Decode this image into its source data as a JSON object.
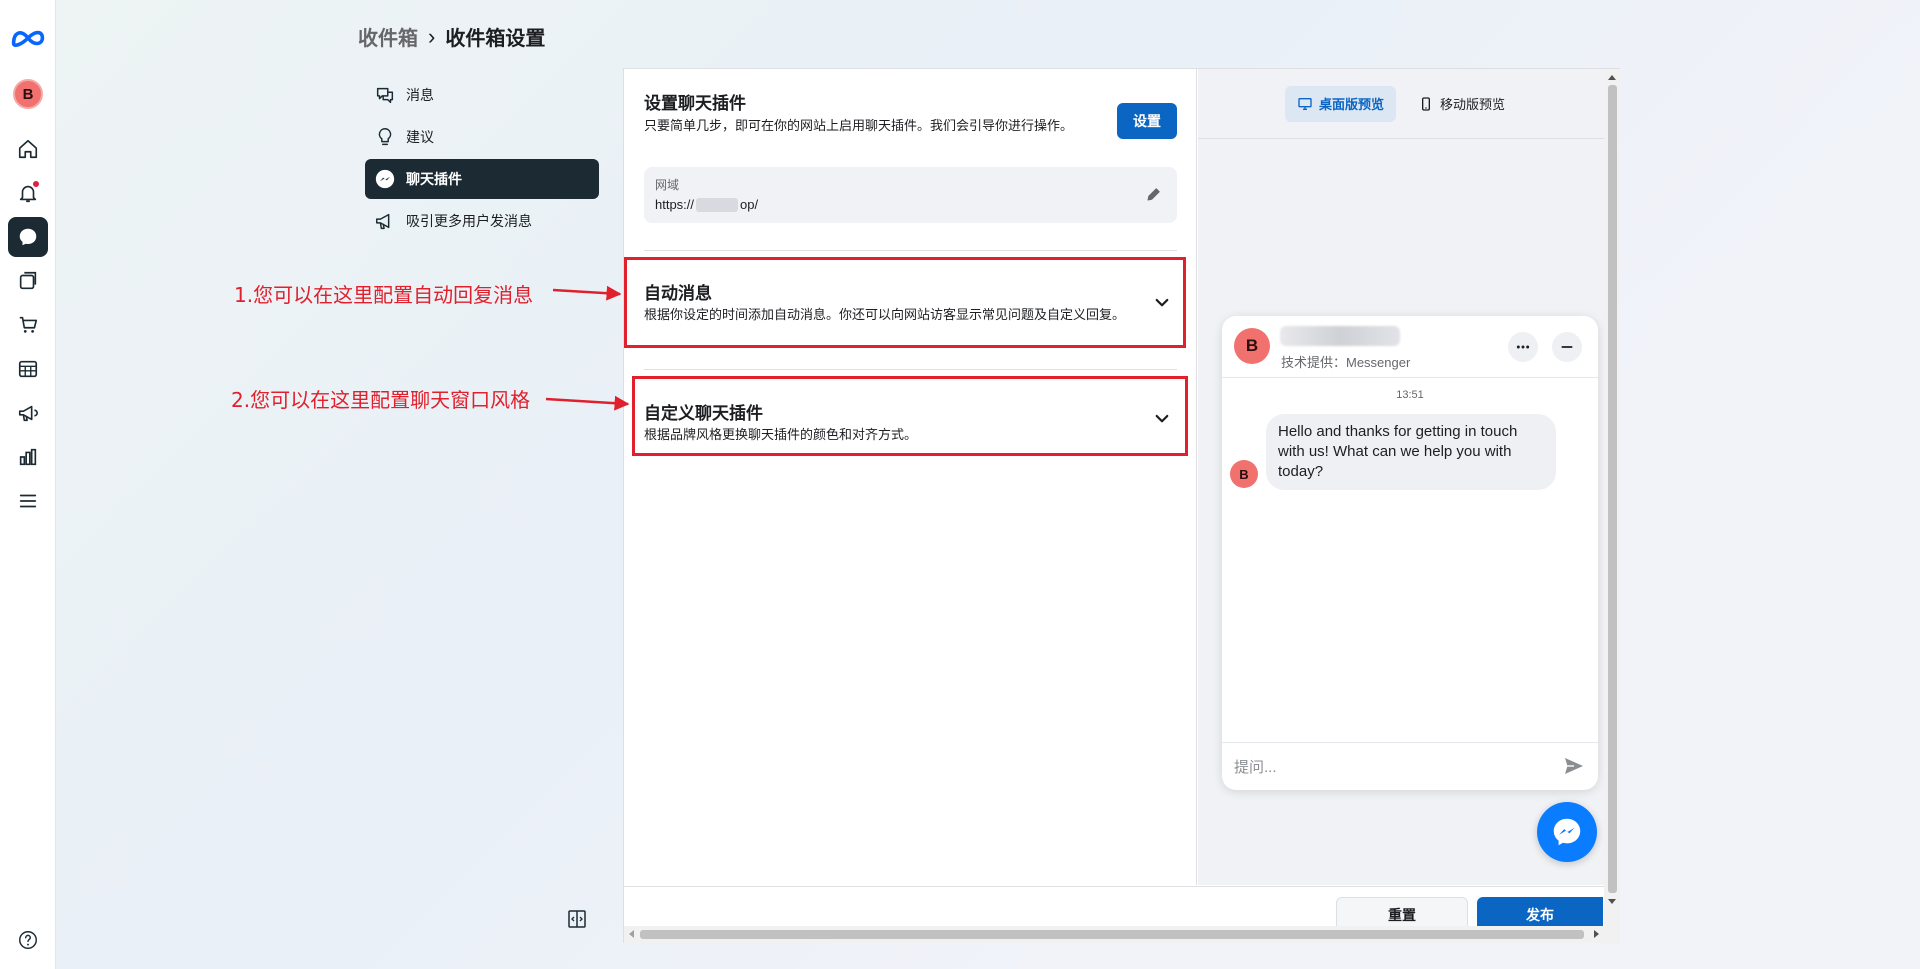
{
  "rail": {
    "logo_icon": "meta-logo-icon",
    "account_initial": "B",
    "items": [
      {
        "icon": "home-icon"
      },
      {
        "icon": "bell-icon",
        "has_dot": true
      },
      {
        "icon": "chat-bubble-icon",
        "active": true
      },
      {
        "icon": "content-icon"
      },
      {
        "icon": "cart-icon"
      },
      {
        "icon": "table-icon"
      },
      {
        "icon": "megaphone-icon"
      },
      {
        "icon": "bar-chart-icon"
      },
      {
        "icon": "menu-icon"
      }
    ],
    "help_icon": "help-icon"
  },
  "breadcrumb": {
    "parent": "收件箱",
    "separator": "›",
    "current": "收件箱设置"
  },
  "sub_menu": {
    "items": [
      {
        "label": "消息",
        "icon": "chat-icon"
      },
      {
        "label": "建议",
        "icon": "lightbulb-icon"
      },
      {
        "label": "聊天插件",
        "icon": "messenger-icon",
        "active": true
      },
      {
        "label": "吸引更多用户发消息",
        "icon": "megaphone-icon"
      }
    ]
  },
  "setup": {
    "title": "设置聊天插件",
    "description": "只要简单几步，即可在你的网站上启用聊天插件。我们会引导你进行操作。",
    "button": "设置",
    "domain_label": "网域",
    "domain_prefix": "https://",
    "domain_suffix": "op/"
  },
  "accordions": [
    {
      "title": "自动消息",
      "description": "根据你设定的时间添加自动消息。你还可以向网站访客显示常见问题及自定义回复。"
    },
    {
      "title": "自定义聊天插件",
      "description": "根据品牌风格更换聊天插件的颜色和对齐方式。"
    }
  ],
  "preview": {
    "tabs": [
      {
        "label": "桌面版预览",
        "icon": "desktop-icon",
        "active": true
      },
      {
        "label": "移动版预览",
        "icon": "mobile-icon"
      }
    ],
    "chat": {
      "avatar_initial": "B",
      "powered_by": "技术提供：Messenger",
      "time": "13:51",
      "message": "Hello and thanks for getting in touch with us! What can we help you with today?",
      "input_placeholder": "提问..."
    }
  },
  "footer": {
    "reset": "重置",
    "publish": "发布"
  },
  "annotations": [
    {
      "text": "1.您可以在这里配置自动回复消息"
    },
    {
      "text": "2.您可以在这里配置聊天窗口风格"
    }
  ],
  "colors": {
    "accent": "#0a66c2",
    "dark_nav": "#1c2b33",
    "annotation_red": "#e0202d",
    "avatar": "#f0716e",
    "messenger_blue": "#0a7cff"
  }
}
